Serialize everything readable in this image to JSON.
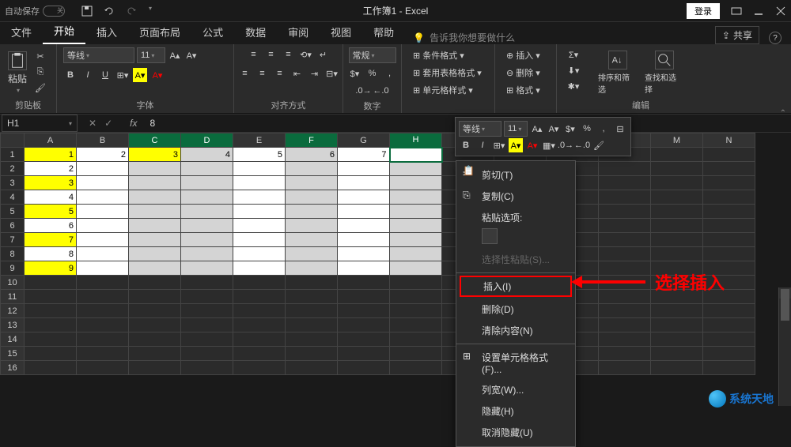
{
  "titlebar": {
    "auto_save": "自动保存",
    "toggle": "关",
    "title": "工作簿1 - Excel",
    "login": "登录"
  },
  "tabs": {
    "file": "文件",
    "home": "开始",
    "insert": "插入",
    "layout": "页面布局",
    "formula": "公式",
    "data": "数据",
    "review": "审阅",
    "view": "视图",
    "help": "帮助",
    "tell_me": "告诉我你想要做什么",
    "share": "共享"
  },
  "ribbon": {
    "clipboard": {
      "label": "剪贴板",
      "paste": "粘贴"
    },
    "font": {
      "label": "字体",
      "name": "等线",
      "size": "11",
      "bold": "B",
      "italic": "I",
      "underline": "U"
    },
    "align": {
      "label": "对齐方式"
    },
    "number": {
      "label": "数字",
      "format": "常规"
    },
    "styles": {
      "conditional": "条件格式",
      "table": "套用表格格式",
      "cell": "单元格样式"
    },
    "cells": {
      "insert": "插入",
      "delete": "删除",
      "format": "格式"
    },
    "editing": {
      "label": "编辑",
      "sort": "排序和筛选",
      "find": "查找和选择"
    }
  },
  "namebox": {
    "ref": "H1",
    "value": "8"
  },
  "mini": {
    "font": "等线",
    "size": "11",
    "bold": "B",
    "italic": "I"
  },
  "context": {
    "cut": "剪切(T)",
    "copy": "复制(C)",
    "paste_opts": "粘贴选项:",
    "paste_special": "选择性粘贴(S)...",
    "insert": "插入(I)",
    "delete": "删除(D)",
    "clear": "清除内容(N)",
    "format_cells": "设置单元格格式(F)...",
    "col_width": "列宽(W)...",
    "hide": "隐藏(H)",
    "unhide": "取消隐藏(U)"
  },
  "annotation": "选择插入",
  "columns": [
    "A",
    "B",
    "C",
    "D",
    "E",
    "F",
    "G",
    "H",
    "I",
    "J",
    "K",
    "L",
    "M",
    "N"
  ],
  "sel_cols": [
    "C",
    "D",
    "F",
    "H"
  ],
  "rows": [
    {
      "r": 1,
      "cells": [
        {
          "c": "A",
          "v": "1",
          "s": "yel"
        },
        {
          "c": "B",
          "v": "2",
          "s": "wht"
        },
        {
          "c": "C",
          "v": "3",
          "s": "yel"
        },
        {
          "c": "D",
          "v": "4",
          "s": "gsel"
        },
        {
          "c": "E",
          "v": "5",
          "s": "wht"
        },
        {
          "c": "F",
          "v": "6",
          "s": "gsel"
        },
        {
          "c": "G",
          "v": "7",
          "s": "wht"
        },
        {
          "c": "H",
          "v": "",
          "s": "active"
        }
      ]
    },
    {
      "r": 2,
      "cells": [
        {
          "c": "A",
          "v": "2",
          "s": "wht"
        }
      ]
    },
    {
      "r": 3,
      "cells": [
        {
          "c": "A",
          "v": "3",
          "s": "yel"
        }
      ]
    },
    {
      "r": 4,
      "cells": [
        {
          "c": "A",
          "v": "4",
          "s": "wht"
        }
      ]
    },
    {
      "r": 5,
      "cells": [
        {
          "c": "A",
          "v": "5",
          "s": "yel"
        }
      ]
    },
    {
      "r": 6,
      "cells": [
        {
          "c": "A",
          "v": "6",
          "s": "wht"
        }
      ]
    },
    {
      "r": 7,
      "cells": [
        {
          "c": "A",
          "v": "7",
          "s": "yel"
        }
      ]
    },
    {
      "r": 8,
      "cells": [
        {
          "c": "A",
          "v": "8",
          "s": "wht"
        }
      ]
    },
    {
      "r": 9,
      "cells": [
        {
          "c": "A",
          "v": "9",
          "s": "yel"
        }
      ]
    }
  ],
  "total_rows": 16,
  "logo": "系统天地"
}
